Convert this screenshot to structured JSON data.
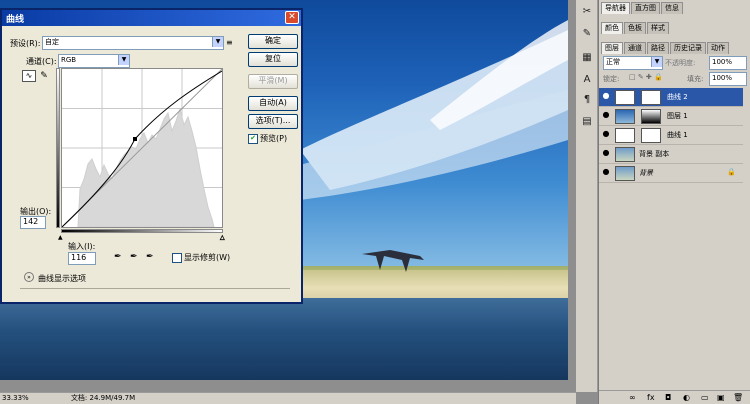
{
  "dialog": {
    "title": "曲线",
    "preset_label": "预设(R):",
    "preset_value": "自定",
    "channel_label": "通道(C):",
    "channel_value": "RGB",
    "output_label": "输出(O):",
    "output_value": "142",
    "input_label": "输入(I):",
    "input_value": "116",
    "show_clipping_label": "显示修剪(W)",
    "preview_label": "预览(P)",
    "preview_checked": true,
    "curve_display_options": "曲线显示选项",
    "buttons": {
      "ok": "确定",
      "reset": "复位",
      "smooth": "平滑(M)",
      "auto": "自动(A)",
      "options": "选项(T)..."
    },
    "curve_point": {
      "input": 116,
      "output": 142
    }
  },
  "right_top_tabs": [
    "导航器",
    "直方图",
    "信息"
  ],
  "right_color_tabs": [
    "颜色",
    "色板",
    "样式"
  ],
  "layers_tabs": [
    "图层",
    "通道",
    "路径",
    "历史记录",
    "动作"
  ],
  "layers": {
    "blend_mode": "正常",
    "opacity_label": "不透明度:",
    "opacity_value": "100%",
    "lock_label": "锁定:",
    "fill_label": "填充:",
    "fill_value": "100%",
    "items": [
      {
        "name": "曲线 2",
        "selected": true
      },
      {
        "name": "图层 1",
        "selected": false
      },
      {
        "name": "曲线 1",
        "selected": false
      },
      {
        "name": "背景 副本",
        "selected": false
      },
      {
        "name": "背景",
        "selected": false
      }
    ]
  },
  "statusbar": {
    "left": "33.33%",
    "doc": "文档: 24.9M/49.7M"
  }
}
